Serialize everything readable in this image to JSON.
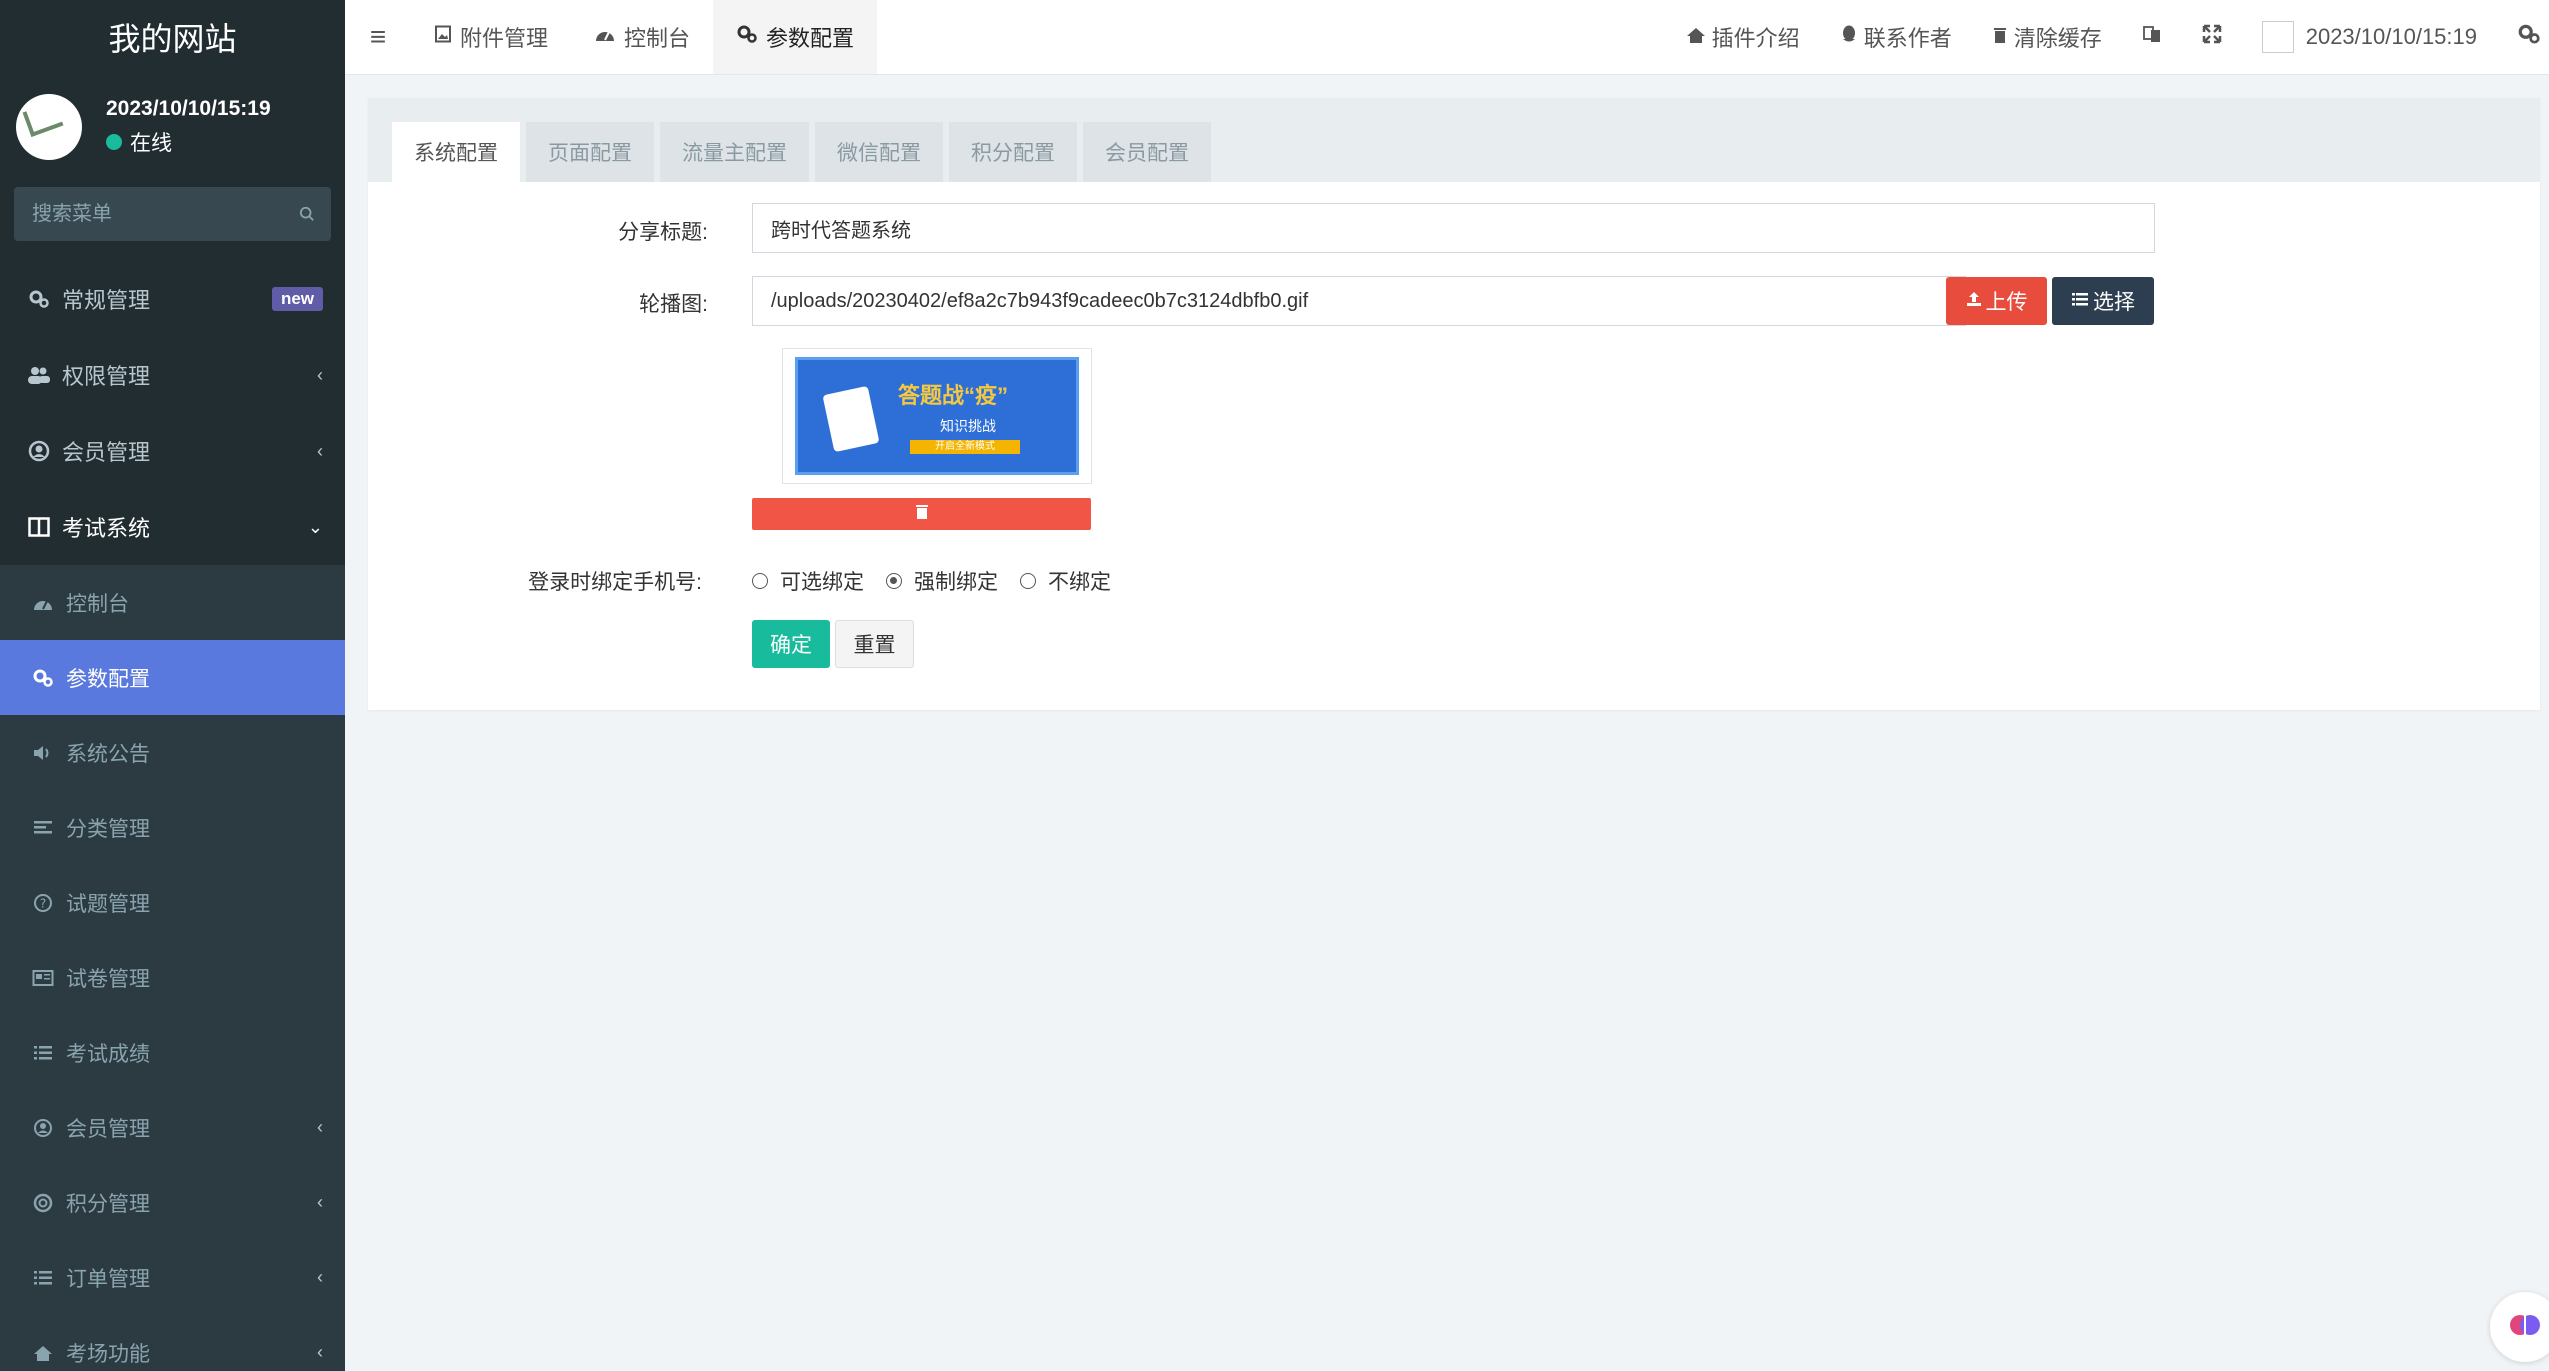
{
  "site": {
    "title": "我的网站"
  },
  "user": {
    "name": "2023/10/10/15:19",
    "status": "在线"
  },
  "search": {
    "placeholder": "搜索菜单"
  },
  "sidebar": {
    "items": [
      {
        "label": "常规管理",
        "badge": "new"
      },
      {
        "label": "权限管理"
      },
      {
        "label": "会员管理"
      },
      {
        "label": "考试系统"
      }
    ],
    "sub_items": [
      {
        "label": "控制台"
      },
      {
        "label": "参数配置"
      },
      {
        "label": "系统公告"
      },
      {
        "label": "分类管理"
      },
      {
        "label": "试题管理"
      },
      {
        "label": "试卷管理"
      },
      {
        "label": "考试成绩"
      },
      {
        "label": "会员管理"
      },
      {
        "label": "积分管理"
      },
      {
        "label": "订单管理"
      },
      {
        "label": "考场功能"
      }
    ]
  },
  "topnav": {
    "tabs": [
      {
        "label": "附件管理"
      },
      {
        "label": "控制台"
      },
      {
        "label": "参数配置"
      }
    ],
    "right": {
      "plugin": "插件介绍",
      "contact": "联系作者",
      "clear_cache": "清除缓存",
      "username": "2023/10/10/15:19"
    }
  },
  "config_tabs": [
    "系统配置",
    "页面配置",
    "流量主配置",
    "微信配置",
    "积分配置",
    "会员配置"
  ],
  "form": {
    "share_title_label": "分享标题:",
    "share_title_value": "跨时代答题系统",
    "banner_label": "轮播图:",
    "banner_value": "/uploads/20230402/ef8a2c7b943f9cadeec0b7c3124dbfb0.gif",
    "upload_label": "上传",
    "choose_label": "选择",
    "bind_label": "登录时绑定手机号:",
    "bind_options": [
      "可选绑定",
      "强制绑定",
      "不绑定"
    ],
    "bind_selected": "强制绑定",
    "submit_label": "确定",
    "reset_label": "重置"
  },
  "banner_image": {
    "title": "答题战“疫”",
    "subtitle": "知识挑战",
    "tag": "开启全新模式"
  }
}
